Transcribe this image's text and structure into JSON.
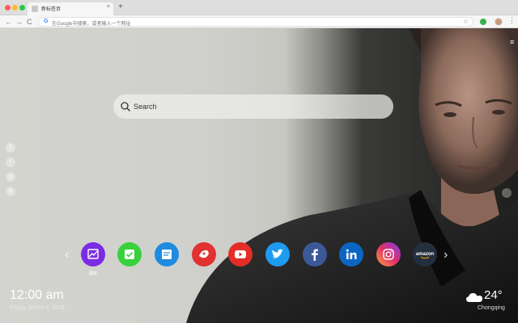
{
  "browser": {
    "tab_title": "新标签页",
    "tab_close": "×",
    "new_tab": "+",
    "omnibox_placeholder": "在Google中搜索，或者输入一个网址",
    "google_mark": "G",
    "bookmark_glyph": "☆",
    "back_glyph": "←",
    "forward_glyph": "→",
    "reload_glyph": "C",
    "menu_glyph": "⋮"
  },
  "page": {
    "menu_glyph": "≡",
    "search": {
      "placeholder": "Search"
    },
    "social_glyphs": [
      "f",
      "t",
      "g",
      "a"
    ],
    "arrow_left": "‹",
    "arrow_right": "›",
    "apps": [
      {
        "name": "gallery",
        "label": "图库",
        "color": "#7b2be3"
      },
      {
        "name": "todo",
        "color": "#39d13b"
      },
      {
        "name": "notes",
        "color": "#1e8be0"
      },
      {
        "name": "games",
        "color": "#e23131"
      },
      {
        "name": "youtube",
        "color": "#e52d27"
      },
      {
        "name": "twitter",
        "color": "#1d9bf0"
      },
      {
        "name": "facebook",
        "color": "#3b5998"
      },
      {
        "name": "linkedin",
        "color": "#0a66c2"
      },
      {
        "name": "instagram",
        "color": "#c13584"
      },
      {
        "name": "amazon",
        "text": "amazon",
        "color": "#232f3e"
      }
    ],
    "clock": "12:00 am",
    "date": "Friday, March 8, 2019",
    "temperature": "24°",
    "city": "Chongqing"
  }
}
